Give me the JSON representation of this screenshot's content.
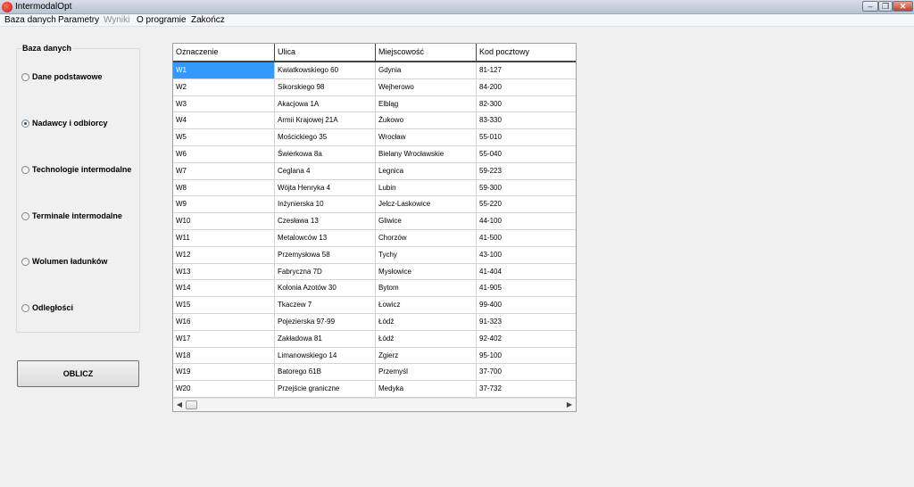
{
  "window": {
    "title": "IntermodalOpt"
  },
  "menu": [
    "Baza danych",
    "Parametry",
    "Wyniki",
    "O programie",
    "Zakończ"
  ],
  "sidebar": {
    "title": "Baza danych",
    "options": [
      {
        "label": "Dane podstawowe",
        "checked": false
      },
      {
        "label": "Nadawcy i odbiorcy",
        "checked": true
      },
      {
        "label": "Technologie intermodalne",
        "checked": false
      },
      {
        "label": "Terminale intermodalne",
        "checked": false
      },
      {
        "label": "Wolumen ładunków",
        "checked": false
      },
      {
        "label": "Odległości",
        "checked": false
      }
    ]
  },
  "compute_button": "OBLICZ",
  "table": {
    "columns": [
      "Oznaczenie",
      "Ulica",
      "Miejscowość",
      "Kod pocztowy"
    ],
    "rows": [
      [
        "W1",
        "Kwiatkowskiego 60",
        "Gdynia",
        "81-127"
      ],
      [
        "W2",
        "Sikorskiego 98",
        "Wejherowo",
        "84-200"
      ],
      [
        "W3",
        "Akacjowa 1A",
        "Elbląg",
        "82-300"
      ],
      [
        "W4",
        "Armii Krajowej 21A",
        "Żukowo",
        "83-330"
      ],
      [
        "W5",
        "Mościckiego 35",
        "Wrocław",
        "55-010"
      ],
      [
        "W6",
        "Świerkowa 8a",
        "Bielany Wrocławskie",
        "55-040"
      ],
      [
        "W7",
        "Ceglana 4",
        "Legnica",
        "59-223"
      ],
      [
        "W8",
        "Wójta Henryka 4",
        "Lubin",
        "59-300"
      ],
      [
        "W9",
        "Inżynierska 10",
        "Jelcz-Laskowice",
        "55-220"
      ],
      [
        "W10",
        "Czesława 13",
        "Gliwice",
        "44-100"
      ],
      [
        "W11",
        "Metalowców 13",
        "Chorzów",
        "41-500"
      ],
      [
        "W12",
        "Przemysłowa 58",
        "Tychy",
        "43-100"
      ],
      [
        "W13",
        "Fabryczna 7D",
        "Mysłowice",
        "41-404"
      ],
      [
        "W14",
        "Kolonia Azotów 30",
        "Bytom",
        "41-905"
      ],
      [
        "W15",
        "Tkaczew 7",
        "Łowicz",
        "99-400"
      ],
      [
        "W16",
        "Pojezierska 97-99",
        "Łódź",
        "91-323"
      ],
      [
        "W17",
        "Zakładowa 81",
        "Łódź",
        "92-402"
      ],
      [
        "W18",
        "Limanowskiego 14",
        "Zgierz",
        "95-100"
      ],
      [
        "W19",
        "Batorego 61B",
        "Przemyśl",
        "37-700"
      ],
      [
        "W20",
        "Przejście graniczne",
        "Medyka",
        "37-732"
      ]
    ],
    "selected": {
      "row": 0,
      "col": 0
    }
  },
  "colors": {
    "selection": "#3399ff",
    "titlebar": "#c8d2de",
    "background": "#f0f0f0"
  },
  "icons": {
    "app": "app-logo-icon",
    "minimize": "minimize-icon",
    "maximize": "maximize-icon",
    "close": "close-icon",
    "scroll_left": "chevron-left-icon",
    "scroll_right": "chevron-right-icon"
  }
}
